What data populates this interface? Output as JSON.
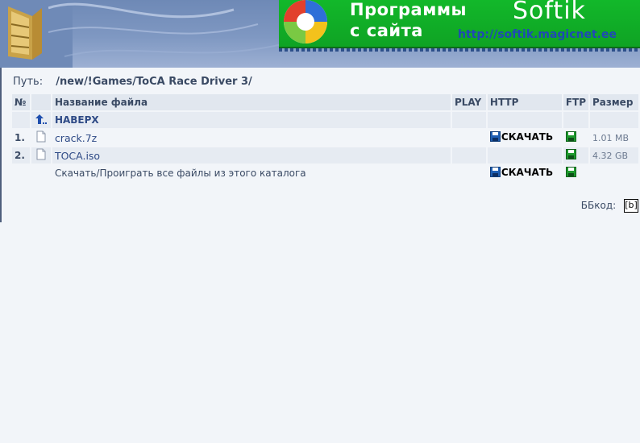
{
  "banner": {
    "line1": "Программы",
    "line2": "с сайта",
    "brand": "Softik",
    "url": "http://softik.magicnet.ee"
  },
  "path": {
    "label": "Путь:",
    "value": "/new/!Games/ToCA Race Driver 3/"
  },
  "table": {
    "headers": {
      "num": "№",
      "name": "Название файла",
      "play": "PLAY",
      "http": "HTTP",
      "ftp": "FTP",
      "size": "Размер"
    },
    "up_label": "НАВЕРХ",
    "rows": [
      {
        "num": "1.",
        "name": "crack.7z",
        "download": "СКАЧАТЬ",
        "size": "1.01 MB"
      },
      {
        "num": "2.",
        "name": "TOCA.iso",
        "download": "",
        "size": "4.32 GB"
      }
    ],
    "all_files_label": "Скачать/Проиграть все файлы из этого каталога",
    "all_files_download": "СКАЧАТЬ"
  },
  "bbcode": {
    "label": "ББкод:",
    "button": "[b]"
  },
  "colors": {
    "banner_green": "#12b82a",
    "header_blue": "#7f98c2",
    "save_icon_blue": "#1f5fb4",
    "save_icon_green": "#1e9a2e"
  },
  "icons": [
    "window-logo-icon",
    "orb-logo-icon",
    "up-arrow-icon",
    "file-icon",
    "save-disk-icon",
    "ftp-disk-icon"
  ]
}
